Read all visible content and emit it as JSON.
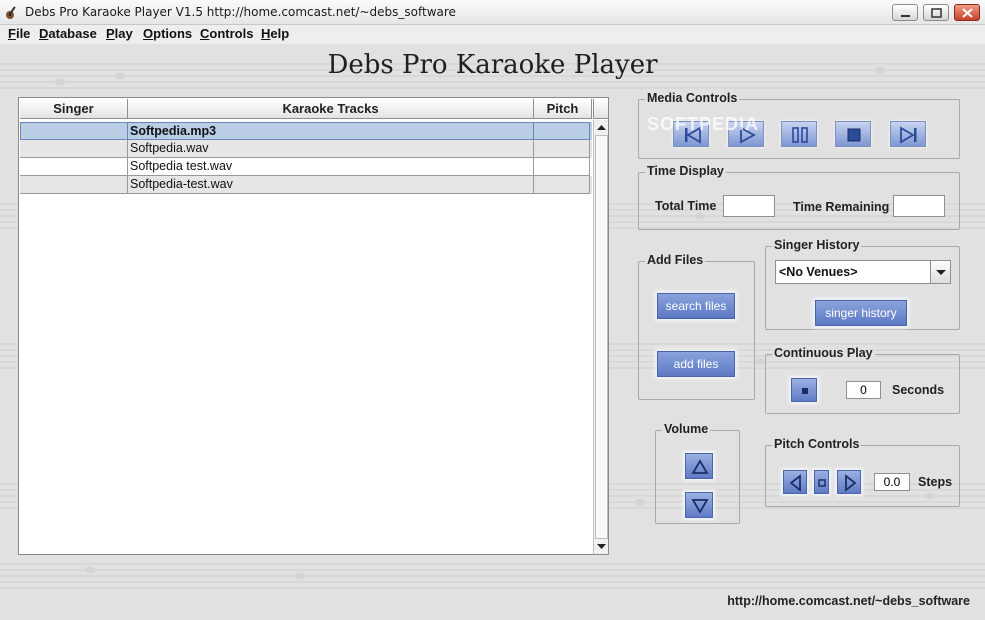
{
  "window": {
    "title": "Debs Pro Karaoke Player  V1.5  http://home.comcast.net/~debs_software"
  },
  "menu": [
    "File",
    "Database",
    "Play",
    "Options",
    "Controls",
    "Help"
  ],
  "app_title": "Debs Pro Karaoke Player",
  "table": {
    "columns": [
      "Singer",
      "Karaoke Tracks",
      "Pitch"
    ],
    "rows": [
      {
        "singer": "",
        "track": "Softpedia.mp3",
        "pitch": "",
        "selected": true
      },
      {
        "singer": "",
        "track": "Softpedia.wav",
        "pitch": ""
      },
      {
        "singer": "",
        "track": "Softpedia test.wav",
        "pitch": ""
      },
      {
        "singer": "",
        "track": "Softpedia-test.wav",
        "pitch": ""
      }
    ]
  },
  "media_controls": {
    "title": "Media Controls",
    "buttons": [
      "previous-icon",
      "play-icon",
      "pause-icon",
      "stop-icon",
      "next-icon"
    ]
  },
  "time_display": {
    "title": "Time Display",
    "total_label": "Total Time",
    "total_value": "",
    "remaining_label": "Time Remaining",
    "remaining_value": ""
  },
  "add_files": {
    "title": "Add Files",
    "search_label": "search files",
    "add_label": "add files"
  },
  "singer_history": {
    "title": "Singer History",
    "venue_selected": "<No Venues>",
    "button_label": "singer history"
  },
  "continuous_play": {
    "title": "Continuous Play",
    "seconds_value": "0",
    "seconds_label": "Seconds"
  },
  "volume": {
    "title": "Volume"
  },
  "pitch_controls": {
    "title": "Pitch Controls",
    "steps_value": "0.0",
    "steps_label": "Steps"
  },
  "footer_url": "http://home.comcast.net/~debs_software",
  "watermark": "SOFTPEDIA",
  "colors": {
    "button_blue": "#6a85cb",
    "selection": "#b9cde5",
    "background": "#e1e1e1"
  }
}
